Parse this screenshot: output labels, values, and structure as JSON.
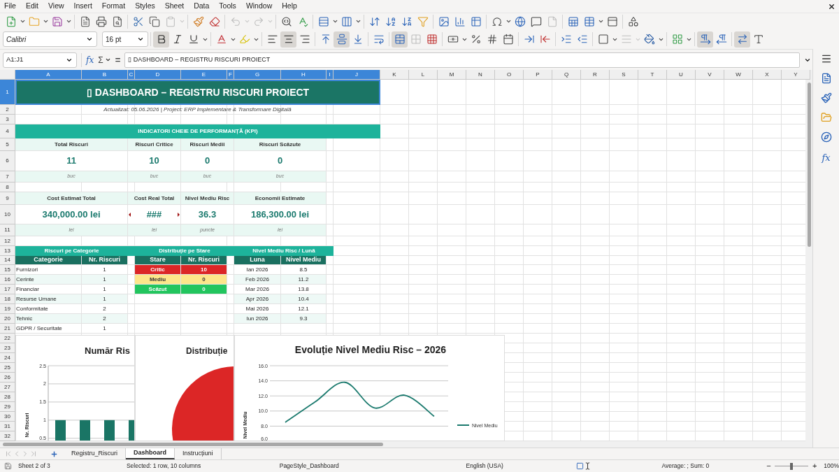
{
  "menu": [
    "File",
    "Edit",
    "View",
    "Insert",
    "Format",
    "Styles",
    "Sheet",
    "Data",
    "Tools",
    "Window",
    "Help"
  ],
  "toolbar_states": {
    "paste_disabled": true,
    "undo_disabled": true,
    "redo_disabled": true
  },
  "format_states": {
    "bold": true,
    "italic": false,
    "underline": false,
    "align_left": false,
    "align_center": true,
    "align_right": false,
    "valign_top": false,
    "valign_center": true,
    "valign_bottom": false,
    "merge": true,
    "ltr": true,
    "rtl": false,
    "text_direction": true
  },
  "font_name": "Calibri",
  "font_size": "16 pt",
  "name_box": "A1:J1",
  "function_wizard": "fx",
  "sum_symbol": "Σ",
  "equals": "=",
  "formula": "▯ DASHBOARD – REGISTRU RISCURI PROIECT",
  "sidebar_functions": "fx",
  "columns": [
    {
      "label": "A",
      "selected": true
    },
    {
      "label": "B",
      "selected": true
    },
    {
      "label": "C",
      "selected": true
    },
    {
      "label": "D",
      "selected": true
    },
    {
      "label": "E",
      "selected": true
    },
    {
      "label": "F",
      "selected": true
    },
    {
      "label": "G",
      "selected": true
    },
    {
      "label": "H",
      "selected": true
    },
    {
      "label": "I",
      "selected": true
    },
    {
      "label": "J",
      "selected": true
    },
    {
      "label": "K",
      "selected": false
    },
    {
      "label": "L",
      "selected": false
    },
    {
      "label": "M",
      "selected": false
    },
    {
      "label": "N",
      "selected": false
    },
    {
      "label": "O",
      "selected": false
    },
    {
      "label": "P",
      "selected": false
    },
    {
      "label": "Q",
      "selected": false
    },
    {
      "label": "R",
      "selected": false
    },
    {
      "label": "S",
      "selected": false
    },
    {
      "label": "T",
      "selected": false
    },
    {
      "label": "U",
      "selected": false
    },
    {
      "label": "V",
      "selected": false
    },
    {
      "label": "W",
      "selected": false
    },
    {
      "label": "X",
      "selected": false
    },
    {
      "label": "Y",
      "selected": false
    }
  ],
  "rows": [
    {
      "label": "1",
      "selected": true
    },
    {
      "label": "2",
      "selected": false
    },
    {
      "label": "3",
      "selected": false
    },
    {
      "label": "4",
      "selected": false
    },
    {
      "label": "5",
      "selected": false
    },
    {
      "label": "6",
      "selected": false
    },
    {
      "label": "7",
      "selected": false
    },
    {
      "label": "8",
      "selected": false
    },
    {
      "label": "9",
      "selected": false
    },
    {
      "label": "10",
      "selected": false
    },
    {
      "label": "11",
      "selected": false
    },
    {
      "label": "12",
      "selected": false
    },
    {
      "label": "13",
      "selected": false
    },
    {
      "label": "14",
      "selected": false
    },
    {
      "label": "15",
      "selected": false
    },
    {
      "label": "16",
      "selected": false
    },
    {
      "label": "17",
      "selected": false
    },
    {
      "label": "18",
      "selected": false
    },
    {
      "label": "19",
      "selected": false
    },
    {
      "label": "20",
      "selected": false
    },
    {
      "label": "21",
      "selected": false
    },
    {
      "label": "22",
      "selected": false
    },
    {
      "label": "23",
      "selected": false
    },
    {
      "label": "24",
      "selected": false
    },
    {
      "label": "25",
      "selected": false
    },
    {
      "label": "26",
      "selected": false
    },
    {
      "label": "27",
      "selected": false
    },
    {
      "label": "28",
      "selected": false
    },
    {
      "label": "29",
      "selected": false
    },
    {
      "label": "30",
      "selected": false
    },
    {
      "label": "31",
      "selected": false
    },
    {
      "label": "32",
      "selected": false
    }
  ],
  "title": "▯ DASHBOARD – REGISTRU RISCURI PROIECT",
  "subtitle": "Actualizat: 05.06.2026 | Project: ERP Implementare & Transformare Digitală",
  "kpi_header": "INDICATORI CHEIE DE PERFORMANȚĂ (KPI)",
  "kpi_groups": [
    {
      "labels": [
        "Total Riscuri",
        "Riscuri Critice",
        "Riscuri Medii",
        "Riscuri Scăzute"
      ],
      "values": [
        {
          "text": "11",
          "overflow": false
        },
        {
          "text": "10",
          "overflow": false
        },
        {
          "text": "0",
          "overflow": false
        },
        {
          "text": "0",
          "overflow": false
        }
      ],
      "units": [
        "buc",
        "buc",
        "buc",
        "buc"
      ]
    },
    {
      "labels": [
        "Cost Estimat Total",
        "Cost Real Total",
        "Nivel Mediu Risc",
        "Economii Estimate"
      ],
      "values": [
        {
          "text": "340,000.00 lei",
          "overflow": false
        },
        {
          "text": "###",
          "overflow": true
        },
        {
          "text": "36.3",
          "overflow": false
        },
        {
          "text": "186,300.00 lei",
          "overflow": false
        }
      ],
      "units": [
        "lei",
        "lei",
        "puncte",
        "lei"
      ]
    }
  ],
  "category_table": {
    "title": "Riscuri pe Categorie",
    "columns": [
      "Categorie",
      "Nr. Riscuri"
    ],
    "rows": [
      [
        "Furnizori",
        "1"
      ],
      [
        "Cerinte",
        "1"
      ],
      [
        "Financiar",
        "1"
      ],
      [
        "Resurse Umane",
        "1"
      ],
      [
        "Conformitate",
        "2"
      ],
      [
        "Tehnic",
        "2"
      ],
      [
        "GDPR / Securitate",
        "1"
      ]
    ]
  },
  "status_table": {
    "title": "Distribuție pe Stare",
    "columns": [
      "Stare",
      "Nr. Riscuri"
    ],
    "rows": [
      {
        "cells": [
          "Critic",
          "10"
        ],
        "color": "#dc2626"
      },
      {
        "cells": [
          "Mediu",
          "0"
        ],
        "color": "#fde68a"
      },
      {
        "cells": [
          "Scăzut",
          "0"
        ],
        "color": "#22c55e"
      }
    ]
  },
  "month_table": {
    "title": "Nivel Mediu Risc / Lună",
    "columns": [
      "Luna",
      "Nivel Mediu"
    ],
    "rows": [
      [
        "Ian 2026",
        "8.5"
      ],
      [
        "Feb 2026",
        "11.2"
      ],
      [
        "Mar 2026",
        "13.8"
      ],
      [
        "Apr 2026",
        "10.4"
      ],
      [
        "Mai 2026",
        "12.1"
      ],
      [
        "Iun 2026",
        "9.3"
      ]
    ]
  },
  "bar_chart": {
    "chart_data": {
      "type": "bar",
      "title": "Număr Ris",
      "ylabel": "Nr. Riscuri",
      "values": [
        1,
        1,
        1,
        1
      ],
      "ylim": [
        0.4,
        2.5
      ],
      "yticks": [
        0.5,
        1,
        1.5,
        2,
        2.5
      ],
      "grid": true
    }
  },
  "pie_chart": {
    "title": "Distribuție"
  },
  "line_chart": {
    "chart_data": {
      "type": "line",
      "title": "Evoluție Nivel Mediu Risc – 2026",
      "ylabel": "Nivel Mediu",
      "ylim": [
        6,
        16
      ],
      "grid": true,
      "series": [
        {
          "name": "Nivel Mediu",
          "color": "#1b7a6e",
          "values": [
            8.5,
            11.2,
            13.8,
            10.4,
            12.1,
            9.3
          ]
        }
      ],
      "yticks": [
        {
          "value": 6,
          "label": "6.0"
        },
        {
          "value": 8,
          "label": "8.0"
        },
        {
          "value": 10,
          "label": "10.0"
        },
        {
          "value": 12,
          "label": "12.0"
        },
        {
          "value": 14,
          "label": "14.0"
        },
        {
          "value": 16,
          "label": "16.0"
        }
      ]
    }
  },
  "sheet_tabs": [
    {
      "label": "Registru_Riscuri",
      "selected": false
    },
    {
      "label": "Dashboard",
      "selected": true
    },
    {
      "label": "Instrucțiuni",
      "selected": false
    }
  ],
  "status_bar": {
    "sheet": "Sheet 2 of 3",
    "selection": "Selected: 1 row, 10 columns",
    "page_style": "PageStyle_Dashboard",
    "language": "English (USA)",
    "summary": "Average: ; Sum: 0",
    "zoom_out": "−",
    "zoom_in": "+",
    "zoom": {
      "level": 0.5,
      "text": "100%"
    }
  }
}
